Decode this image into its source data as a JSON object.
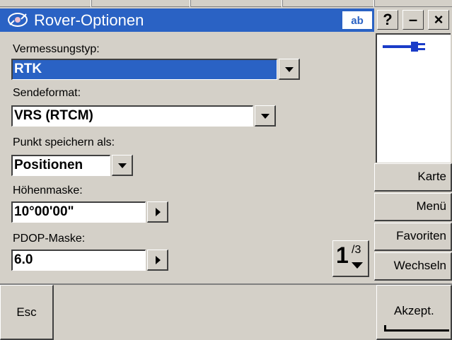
{
  "window": {
    "title": "Rover-Optionen",
    "input_mode_label": "ab",
    "help_label": "?",
    "minimize_label": "–",
    "close_label": "×"
  },
  "form": {
    "survey_type": {
      "label": "Vermessungstyp:",
      "value": "RTK"
    },
    "send_format": {
      "label": "Sendeformat:",
      "value": "VRS (RTCM)"
    },
    "save_point_as": {
      "label": "Punkt speichern als:",
      "value": "Positionen"
    },
    "elevation_mask": {
      "label": "Höhenmaske:",
      "value": "10°00'00\""
    },
    "pdop_mask": {
      "label": "PDOP-Maske:",
      "value": "6.0"
    }
  },
  "pager": {
    "current": "1",
    "total": "/3"
  },
  "side_buttons": {
    "map": "Karte",
    "menu": "Menü",
    "favorites": "Favoriten",
    "switch": "Wechseln"
  },
  "bottom": {
    "esc_label": "Esc",
    "accept_label": "Akzept."
  },
  "icons": {
    "app_icon": "satellite-icon",
    "connection": "plug-icon",
    "page_down": "chevron-down-icon"
  },
  "colors": {
    "accent": "#2a62c4",
    "face": "#d4d0c8"
  }
}
